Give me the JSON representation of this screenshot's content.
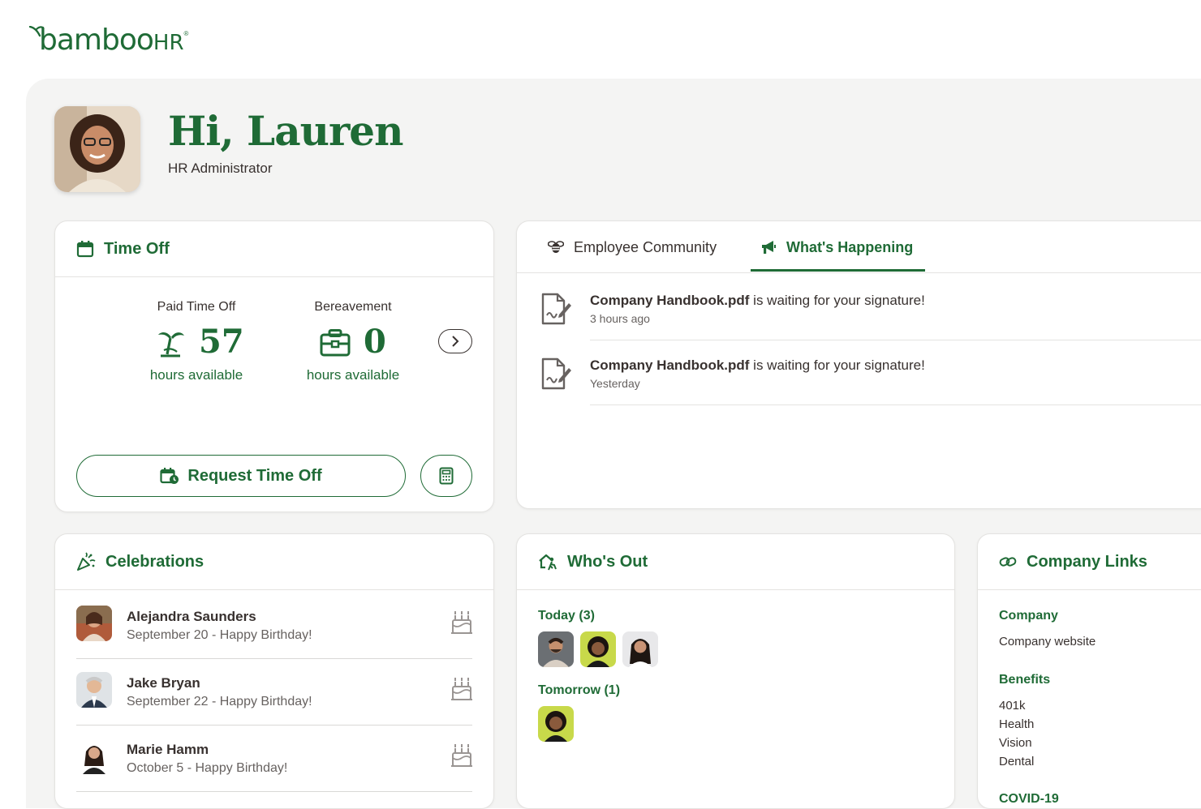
{
  "brand": {
    "logo_text": "bamboo",
    "logo_hr": "HR",
    "logo_reg": "®"
  },
  "colors": {
    "brand_green": "#1f6b36",
    "canvas": "#f4f4f3",
    "card": "#ffffff",
    "text": "#38312f",
    "muted": "#676260"
  },
  "header": {
    "greeting": "Hi, Lauren",
    "role": "HR Administrator"
  },
  "time_off": {
    "title": "Time Off",
    "balances": [
      {
        "label": "Paid Time Off",
        "value": "57",
        "unit": "hours available",
        "icon": "palm-tree-icon"
      },
      {
        "label": "Bereavement",
        "value": "0",
        "unit": "hours available",
        "icon": "briefcase-icon"
      }
    ],
    "request_label": "Request Time Off"
  },
  "feed": {
    "tabs": [
      {
        "label": "Employee Community",
        "icon": "bee-icon",
        "active": false
      },
      {
        "label": "What's Happening",
        "icon": "megaphone-icon",
        "active": true
      }
    ],
    "items": [
      {
        "doc": "Company Handbook.pdf",
        "message": " is waiting for your signature!",
        "time": "3 hours ago"
      },
      {
        "doc": "Company Handbook.pdf",
        "message": " is waiting for your signature!",
        "time": "Yesterday"
      }
    ]
  },
  "celebrations": {
    "title": "Celebrations",
    "items": [
      {
        "name": "Alejandra Saunders",
        "detail": "September 20 - Happy Birthday!"
      },
      {
        "name": "Jake Bryan",
        "detail": "September 22 - Happy Birthday!"
      },
      {
        "name": "Marie Hamm",
        "detail": "October 5 - Happy Birthday!"
      }
    ]
  },
  "whos_out": {
    "title": "Who's Out",
    "today_label": "Today (3)",
    "tomorrow_label": "Tomorrow (1)"
  },
  "company_links": {
    "title": "Company Links",
    "groups": [
      {
        "heading": "Company",
        "links": [
          "Company website"
        ]
      },
      {
        "heading": "Benefits",
        "links": [
          "401k",
          "Health",
          "Vision",
          "Dental"
        ]
      },
      {
        "heading": "COVID-19",
        "links": []
      }
    ]
  }
}
